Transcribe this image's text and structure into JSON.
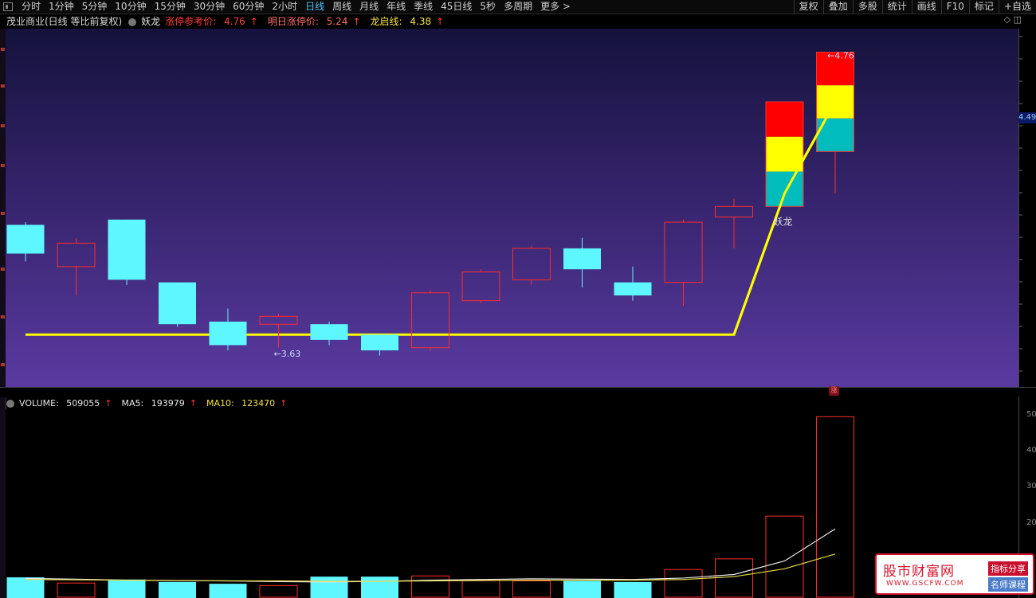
{
  "toolbar": {
    "periods": [
      "分时",
      "1分钟",
      "5分钟",
      "10分钟",
      "15分钟",
      "30分钟",
      "60分钟",
      "2小时",
      "日线",
      "周线",
      "月线",
      "年线",
      "季线",
      "45日线",
      "5秒",
      "多周期",
      "更多 >"
    ],
    "active_index": 8,
    "right_items": [
      "复权",
      "叠加",
      "多股",
      "统计",
      "画线",
      "F10",
      "标记",
      "+自选"
    ]
  },
  "info": {
    "stock_name": "茂业商业(日线 等比前复权)",
    "indicator_name": "妖龙",
    "limit_ref_label": "涨停参考价:",
    "limit_ref_value": "4.76",
    "tomorrow_label": "明日涨停价:",
    "tomorrow_value": "5.24",
    "dragon_label": "龙启线:",
    "dragon_value": "4.38",
    "up_arrow": "↑",
    "right_icons": "◇ ◫"
  },
  "price_panel": {
    "right_tag": "4.49",
    "low_label": "←3.63",
    "high_label": "←4.76",
    "yaolong_label": "妖龙",
    "dragon_line_value": 4.38,
    "candles": [
      {
        "o": 4.1,
        "h": 4.11,
        "l": 3.96,
        "c": 3.99,
        "color": "cyan"
      },
      {
        "o": 3.94,
        "h": 4.05,
        "l": 3.83,
        "c": 4.03,
        "color": "red"
      },
      {
        "o": 4.12,
        "h": 4.12,
        "l": 3.87,
        "c": 3.89,
        "color": "cyan"
      },
      {
        "o": 3.88,
        "h": 3.88,
        "l": 3.71,
        "c": 3.72,
        "color": "cyan"
      },
      {
        "o": 3.73,
        "h": 3.78,
        "l": 3.62,
        "c": 3.64,
        "color": "cyan"
      },
      {
        "o": 3.72,
        "h": 3.76,
        "l": 3.63,
        "c": 3.75,
        "color": "red"
      },
      {
        "o": 3.72,
        "h": 3.73,
        "l": 3.64,
        "c": 3.66,
        "color": "cyan"
      },
      {
        "o": 3.68,
        "h": 3.68,
        "l": 3.6,
        "c": 3.62,
        "color": "cyan"
      },
      {
        "o": 3.63,
        "h": 3.85,
        "l": 3.62,
        "c": 3.84,
        "color": "red"
      },
      {
        "o": 3.81,
        "h": 3.93,
        "l": 3.8,
        "c": 3.92,
        "color": "red"
      },
      {
        "o": 3.89,
        "h": 4.02,
        "l": 3.87,
        "c": 4.01,
        "color": "red"
      },
      {
        "o": 4.01,
        "h": 4.05,
        "l": 3.86,
        "c": 3.93,
        "color": "cyan"
      },
      {
        "o": 3.88,
        "h": 3.94,
        "l": 3.81,
        "c": 3.83,
        "color": "cyan"
      },
      {
        "o": 3.88,
        "h": 4.12,
        "l": 3.79,
        "c": 4.11,
        "color": "red"
      },
      {
        "o": 4.13,
        "h": 4.2,
        "l": 4.01,
        "c": 4.17,
        "color": "red"
      },
      {
        "o": 4.17,
        "h": 4.57,
        "l": 4.17,
        "c": 4.57,
        "color": "stack"
      },
      {
        "o": 4.38,
        "h": 4.76,
        "l": 4.22,
        "c": 4.76,
        "color": "stack"
      }
    ]
  },
  "volume_panel": {
    "volume_label": "VOLUME:",
    "volume_value": "509055",
    "ma5_label": "MA5:",
    "ma5_value": "193979",
    "ma10_label": "MA10:",
    "ma10_value": "123470",
    "tick_labels": [
      "50",
      "40",
      "30",
      "20"
    ],
    "bars": [
      {
        "v": 58000,
        "color": "cyan"
      },
      {
        "v": 42000,
        "color": "red"
      },
      {
        "v": 52000,
        "color": "cyan"
      },
      {
        "v": 45000,
        "color": "cyan"
      },
      {
        "v": 40000,
        "color": "cyan"
      },
      {
        "v": 35000,
        "color": "red"
      },
      {
        "v": 60000,
        "color": "cyan"
      },
      {
        "v": 60000,
        "color": "cyan"
      },
      {
        "v": 62000,
        "color": "red"
      },
      {
        "v": 50000,
        "color": "red"
      },
      {
        "v": 48000,
        "color": "red"
      },
      {
        "v": 48000,
        "color": "cyan"
      },
      {
        "v": 45000,
        "color": "cyan"
      },
      {
        "v": 80000,
        "color": "red"
      },
      {
        "v": 110000,
        "color": "red"
      },
      {
        "v": 230000,
        "color": "red"
      },
      {
        "v": 509055,
        "color": "red"
      }
    ],
    "ma5": [
      55000,
      53000,
      50000,
      49000,
      48000,
      46000,
      45000,
      47000,
      50000,
      52000,
      54000,
      53000,
      52000,
      56000,
      66000,
      104000,
      193979
    ],
    "ma10": [
      52000,
      51000,
      50000,
      49000,
      48000,
      48000,
      47000,
      47000,
      48000,
      49000,
      50000,
      50000,
      50000,
      52000,
      60000,
      82000,
      123470
    ]
  },
  "left_strip_text": "",
  "watermark": {
    "title": "股市财富网",
    "url": "WWW.GSCFW.COM",
    "tag1": "指标分享",
    "tag2": "名师课程"
  },
  "colors": {
    "cyan": "#5ef6ff",
    "red": "#ff2a2a",
    "yellow": "#ffff00",
    "teal": "#00bcbc"
  }
}
